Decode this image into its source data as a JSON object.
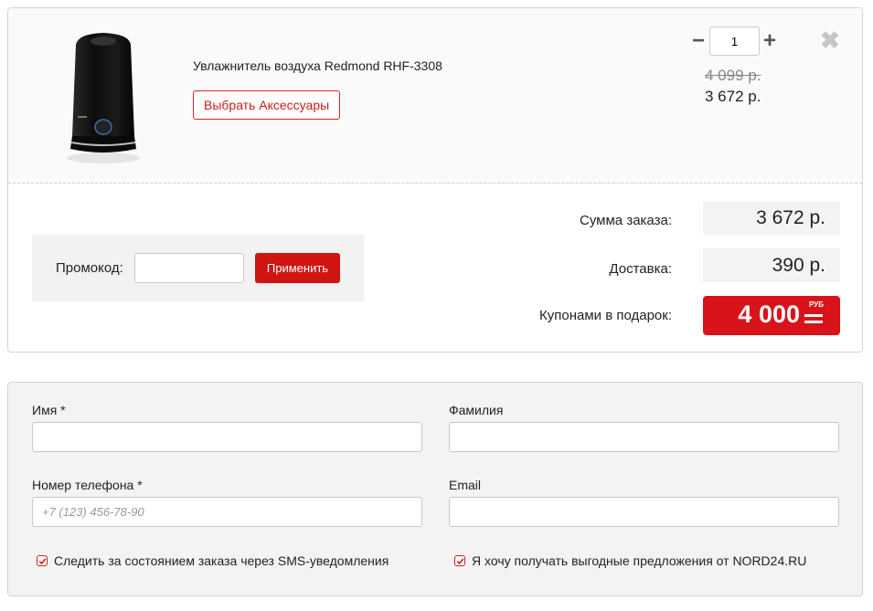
{
  "cart": {
    "item": {
      "name": "Увлажнитель воздуха Redmond RHF-3308",
      "accessories_label": "Выбрать Аксессуары",
      "quantity": "1",
      "qty_minus": "−",
      "qty_plus": "+",
      "old_price": "4 099 р.",
      "price": "3 672 р.",
      "remove_glyph": "✖"
    },
    "promo": {
      "label": "Промокод:",
      "value": "",
      "apply_label": "Применить"
    },
    "summary": {
      "order_sum_label": "Сумма заказа:",
      "order_sum_value": "3 672 р.",
      "delivery_label": "Доставка:",
      "delivery_value": "390 р.",
      "coupons_label": "Купонами в подарок:",
      "coupons_value": "4 000",
      "coupons_unit": "РУБ"
    }
  },
  "form": {
    "first_name_label": "Имя *",
    "first_name_value": "",
    "last_name_label": "Фамилия",
    "last_name_value": "",
    "phone_label": "Номер телефона *",
    "phone_placeholder": "+7 (123) 456-78-90",
    "email_label": "Email",
    "email_value": "",
    "sms_checkbox_label": "Следить за состоянием заказа через SMS-уведомления",
    "sms_checked": true,
    "offers_checkbox_label": "Я хочу получать выгодные предложения от NORD24.RU",
    "offers_checked": true
  },
  "colors": {
    "accent": "#d01510",
    "coupon_bg": "#d8141a",
    "panel_bg": "#f3f3f3"
  },
  "icons": {
    "remove": "close-icon",
    "checkbox": "checkmark-icon"
  }
}
